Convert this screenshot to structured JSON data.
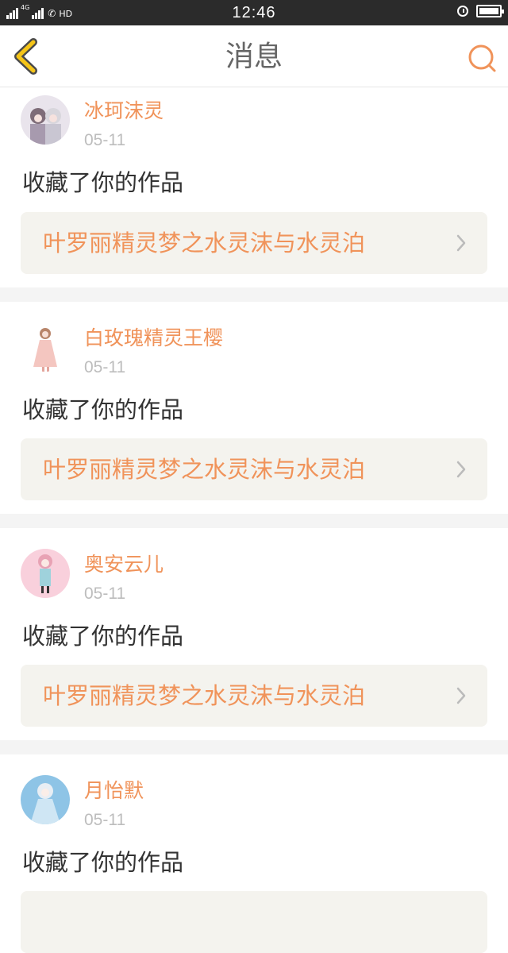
{
  "status": {
    "network": "4G",
    "hd": "HD",
    "time": "12:46"
  },
  "header": {
    "title": "消息"
  },
  "colors": {
    "accent": "#f0935a",
    "back_icon": "#f5c518",
    "card_bg": "#f4f3ee"
  },
  "messages": [
    {
      "username": "冰珂沫灵",
      "date": "05-11",
      "action": "收藏了你的作品",
      "work_title": "叶罗丽精灵梦之水灵沫与水灵泊"
    },
    {
      "username": "白玫瑰精灵王樱",
      "date": "05-11",
      "action": "收藏了你的作品",
      "work_title": "叶罗丽精灵梦之水灵沫与水灵泊"
    },
    {
      "username": "奥安云儿",
      "date": "05-11",
      "action": "收藏了你的作品",
      "work_title": "叶罗丽精灵梦之水灵沫与水灵泊"
    },
    {
      "username": "月怡默",
      "date": "05-11",
      "action": "收藏了你的作品",
      "work_title": ""
    }
  ]
}
